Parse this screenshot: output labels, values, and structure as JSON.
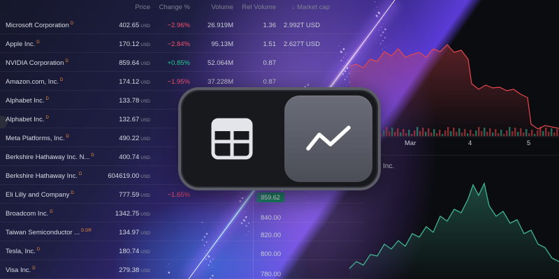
{
  "table": {
    "headers": {
      "price": "Price",
      "change": "Change %",
      "volume": "Volume",
      "rel_volume": "Rel Volume",
      "market_cap": "↓  Market cap"
    },
    "rows": [
      {
        "name": "Microsoft Corporation",
        "flag": "D",
        "price": "402.65",
        "currency": "USD",
        "change": "−2.96%",
        "dir": "neg",
        "volume": "26.919M",
        "rel": "1.36",
        "cap": "2.992T USD"
      },
      {
        "name": "Apple Inc.",
        "flag": "D",
        "price": "170.12",
        "currency": "USD",
        "change": "−2.84%",
        "dir": "neg",
        "volume": "95.13M",
        "rel": "1.51",
        "cap": "2.627T USD"
      },
      {
        "name": "NVIDIA Corporation",
        "flag": "D",
        "price": "859.64",
        "currency": "USD",
        "change": "+0.85%",
        "dir": "pos",
        "volume": "52.064M",
        "rel": "0.87",
        "cap": ""
      },
      {
        "name": "Amazon.com, Inc.",
        "flag": "D",
        "price": "174.12",
        "currency": "USD",
        "change": "−1.95%",
        "dir": "neg",
        "volume": "37.228M",
        "rel": "0.87",
        "cap": ""
      },
      {
        "name": "Alphabet Inc.",
        "flag": "D",
        "price": "133.78",
        "currency": "USD",
        "change": "−0.",
        "dir": "neg",
        "volume": "",
        "rel": "",
        "cap": ""
      },
      {
        "name": "Alphabet Inc.",
        "flag": "D",
        "price": "132.67",
        "currency": "USD",
        "change": "−0.",
        "dir": "neg",
        "volume": "",
        "rel": "",
        "cap": ""
      },
      {
        "name": "Meta Platforms, Inc.",
        "flag": "D",
        "price": "490.22",
        "currency": "USD",
        "change": "−1",
        "dir": "neg",
        "volume": "",
        "rel": "",
        "cap": ""
      },
      {
        "name": "Berkshire Hathaway Inc. N...",
        "flag": "D",
        "price": "400.74",
        "currency": "USD",
        "change": "−0.",
        "dir": "neg",
        "volume": "",
        "rel": "",
        "cap": ""
      },
      {
        "name": "Berkshire Hathaway Inc.",
        "flag": "D",
        "price": "604619.00",
        "currency": "USD",
        "change": "−0.",
        "dir": "neg",
        "volume": "",
        "rel": "",
        "cap": ""
      },
      {
        "name": "Eli Lilly and Company",
        "flag": "D",
        "price": "777.59",
        "currency": "USD",
        "change": "−1.65%",
        "dir": "neg",
        "volume": "",
        "rel": "",
        "cap": ""
      },
      {
        "name": "Broadcom Inc.",
        "flag": "D",
        "price": "1342.75",
        "currency": "USD",
        "change": "",
        "dir": "neg",
        "volume": "",
        "rel": "",
        "cap": ""
      },
      {
        "name": "Taiwan Semiconductor ...",
        "flag": "D DR",
        "price": "134.97",
        "currency": "USD",
        "change": "",
        "dir": "neg",
        "volume": "",
        "rel": "",
        "cap": ""
      },
      {
        "name": "Tesla, Inc.",
        "flag": "D",
        "price": "180.74",
        "currency": "USD",
        "change": "",
        "dir": "neg",
        "volume": "",
        "rel": "",
        "cap": ""
      },
      {
        "name": "Visa Inc.",
        "flag": "D",
        "price": "279.38",
        "currency": "USD",
        "change": "",
        "dir": "neg",
        "volume": "",
        "rel": "",
        "cap": ""
      }
    ]
  },
  "chart_top": {
    "x_labels": [
      "Mar",
      "4",
      "5"
    ],
    "color": "#e5484d"
  },
  "chart_bottom": {
    "title": "Inc.",
    "current_price": "859.62",
    "y_labels": [
      "840.00",
      "820.00",
      "800.00",
      "780.00"
    ],
    "color": "#3fb58f"
  },
  "toggle": {
    "active": "chart",
    "options": [
      "table-icon",
      "line-chart-icon"
    ]
  }
}
